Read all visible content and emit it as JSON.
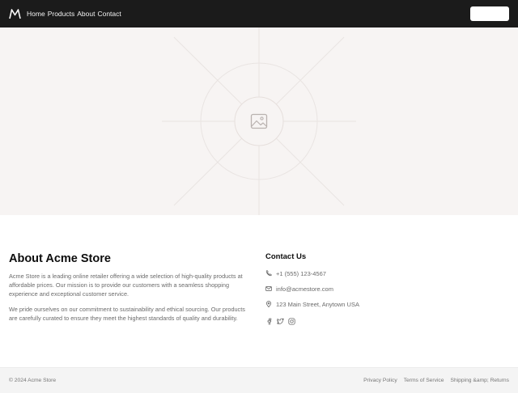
{
  "header": {
    "logo_icon": "mountain-logo-icon",
    "nav": [
      "Home",
      "Products",
      "About",
      "Contact"
    ],
    "button_label": ""
  },
  "hero": {
    "image_icon": "image-placeholder-icon"
  },
  "about": {
    "title": "About Acme Store",
    "paragraph1": "Acme Store is a leading online retailer offering a wide selection of high-quality products at affordable prices. Our mission is to provide our customers with a seamless shopping experience and exceptional customer service.",
    "paragraph2": "We pride ourselves on our commitment to sustainability and ethical sourcing. Our products are carefully curated to ensure they meet the highest standards of quality and durability."
  },
  "contact": {
    "title": "Contact Us",
    "phone": "+1 (555) 123-4567",
    "email": "info@acmestore.com",
    "address": "123 Main Street, Anytown USA",
    "socials": [
      "facebook-icon",
      "twitter-icon",
      "instagram-icon"
    ]
  },
  "footer": {
    "copyright": "© 2024 Acme Store",
    "links": [
      "Privacy Policy",
      "Terms of Service",
      "Shipping &amp; Returns"
    ]
  },
  "colors": {
    "header_bg": "#1b1b1b",
    "hero_bg": "#f7f4f3",
    "footer_bg": "#f4f4f4"
  }
}
